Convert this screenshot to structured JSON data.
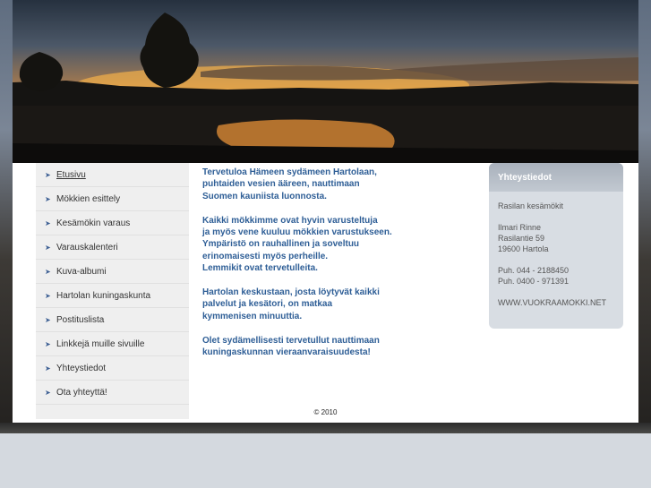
{
  "nav": {
    "items": [
      {
        "label": "Etusivu",
        "active": true
      },
      {
        "label": "Mökkien esittely"
      },
      {
        "label": "Kesämökin varaus"
      },
      {
        "label": "Varauskalenteri"
      },
      {
        "label": "Kuva-albumi"
      },
      {
        "label": "Hartolan kuningaskunta"
      },
      {
        "label": "Postituslista"
      },
      {
        "label": "Linkkejä muille sivuille"
      },
      {
        "label": "Yhteystiedot"
      },
      {
        "label": "Ota yhteyttä!"
      }
    ]
  },
  "content": {
    "paragraphs": [
      [
        "Tervetuloa Hämeen sydämeen Hartolaan,",
        "puhtaiden vesien ääreen, nauttimaan",
        "Suomen kauniista luonnosta."
      ],
      [
        "Kaikki mökkimme ovat hyvin varusteltuja",
        "ja myös vene kuuluu mökkien varustukseen.",
        "Ympäristö on rauhallinen ja soveltuu",
        "erinomaisesti myös perheille.",
        "Lemmikit ovat tervetulleita."
      ],
      [
        "Hartolan keskustaan, josta löytyvät kaikki",
        "palvelut ja kesätori, on matkaa",
        "kymmenisen minuuttia."
      ],
      [
        "Olet sydämellisesti tervetullut nauttimaan",
        "kuningaskunnan vieraanvaraisuudesta!"
      ]
    ]
  },
  "contact": {
    "title": "Yhteystiedot",
    "company": "Rasilan kesämökit",
    "name": "Ilmari Rinne",
    "street": "Rasilantie 59",
    "city": "19600 Hartola",
    "phone1": "Puh. 044 - 2188450",
    "phone2": "Puh. 0400 - 971391",
    "web": "WWW.VUOKRAAMOKKI.NET"
  },
  "footer": {
    "copyright": "© 2010"
  },
  "colors": {
    "link_blue": "#2e5e96",
    "sidebar_bg": "#efefef",
    "contact_bg": "#d8dde3"
  }
}
